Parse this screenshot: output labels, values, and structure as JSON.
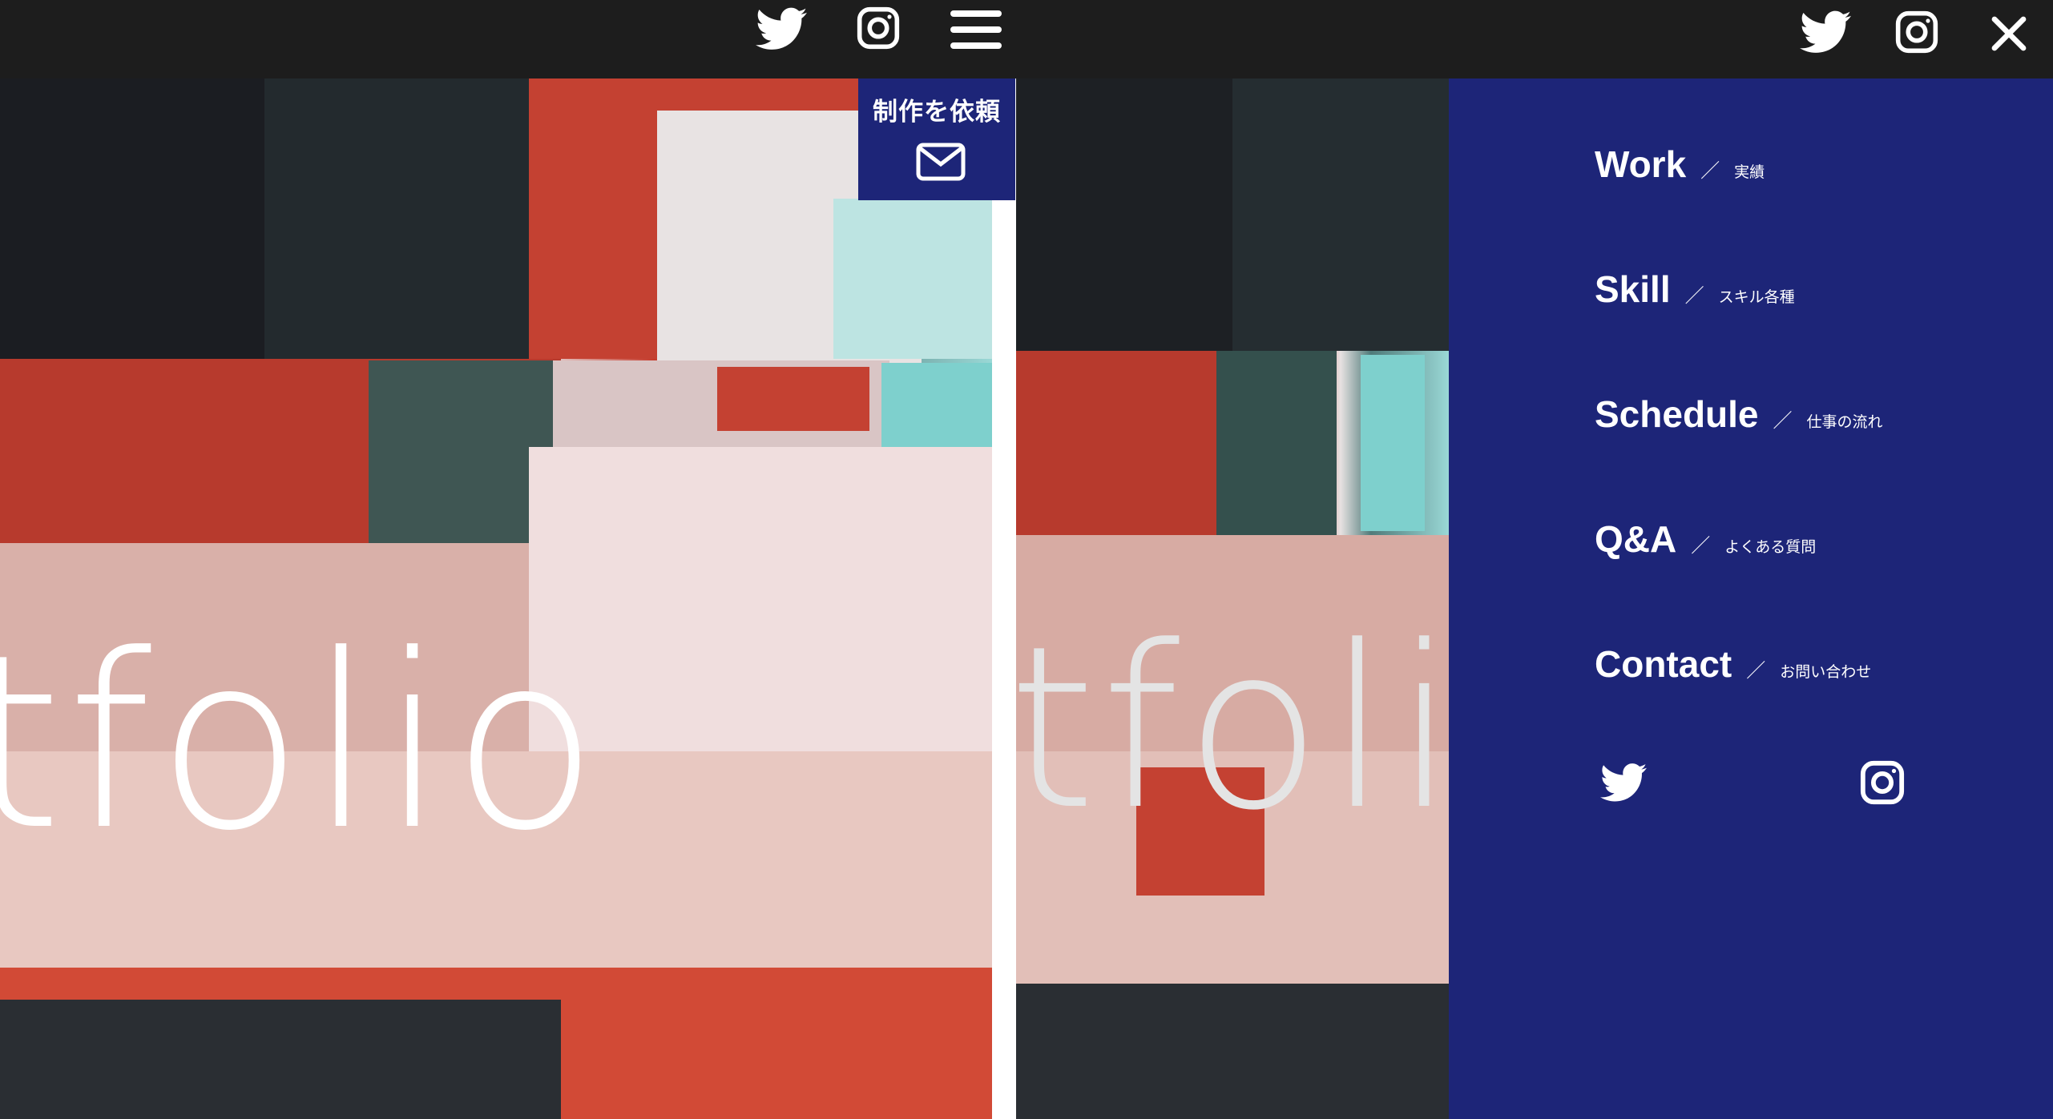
{
  "left": {
    "hero_text": "tfolio",
    "request": {
      "label": "制作を依頼",
      "icon": "mail-icon"
    },
    "header_icons": [
      "twitter-icon",
      "instagram-icon",
      "hamburger-menu-icon"
    ]
  },
  "right": {
    "hero_text": "tfoli",
    "header_icons": [
      "twitter-icon",
      "instagram-icon",
      "close-icon"
    ],
    "menu": [
      {
        "label": "Work",
        "slash": "／",
        "sub": "実績"
      },
      {
        "label": "Skill",
        "slash": "／",
        "sub": "スキル各種"
      },
      {
        "label": "Schedule",
        "slash": "／",
        "sub": "仕事の流れ"
      },
      {
        "label": "Q&A",
        "slash": "／",
        "sub": "よくある質問"
      },
      {
        "label": "Contact",
        "slash": "／",
        "sub": "お問い合わせ"
      }
    ],
    "menu_social": [
      "twitter-icon",
      "instagram-icon"
    ]
  },
  "colors": {
    "header": "#1d1d1d",
    "menu_blue": "#1d2578",
    "accent_red": "#c53a2b",
    "accent_cyan": "#9ad8d6"
  }
}
